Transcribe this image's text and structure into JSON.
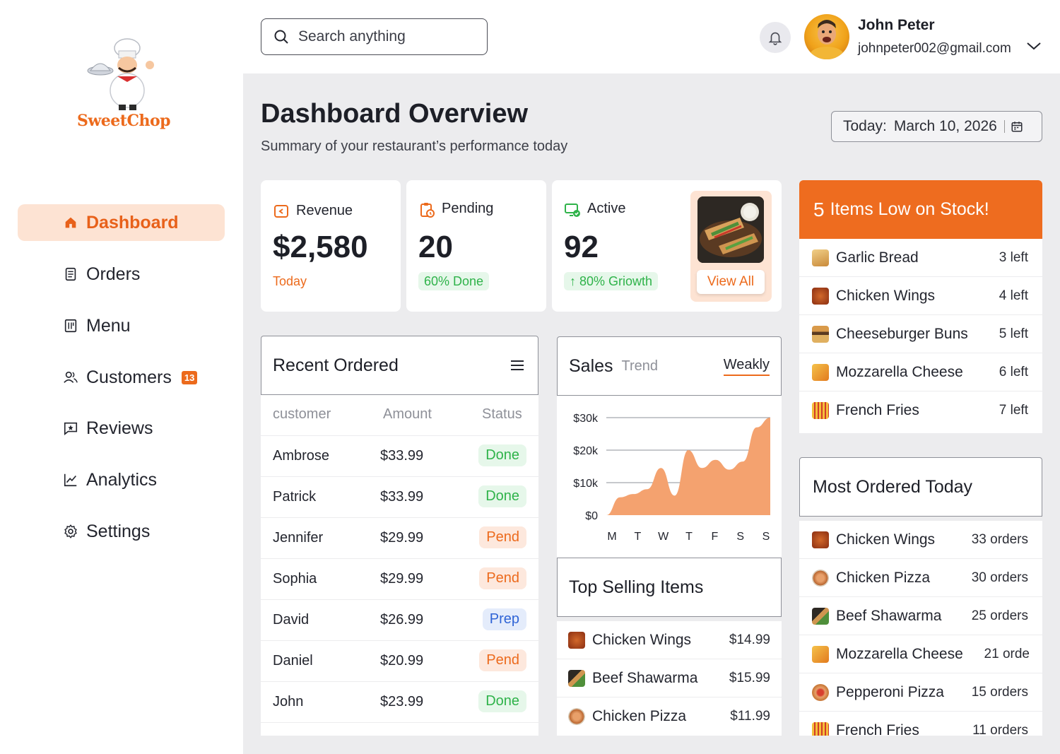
{
  "brand": {
    "name": "SweetChop"
  },
  "sidebar": {
    "items": [
      {
        "label": "Dashboard",
        "icon": "home-icon",
        "active": true
      },
      {
        "label": "Orders",
        "icon": "receipt-icon"
      },
      {
        "label": "Menu",
        "icon": "menu-book-icon"
      },
      {
        "label": "Customers",
        "icon": "users-icon",
        "badge": "13"
      },
      {
        "label": "Reviews",
        "icon": "star-message-icon"
      },
      {
        "label": "Analytics",
        "icon": "chart-line-icon"
      },
      {
        "label": "Settings",
        "icon": "gear-icon"
      }
    ]
  },
  "header": {
    "search_placeholder": "Search anything",
    "user_name": "John Peter",
    "user_email": "johnpeter002@gmail.com"
  },
  "page": {
    "title": "Dashboard Overview",
    "subtitle": "Summary of your restaurant’s performance today",
    "date_label": "Today:",
    "date_value": "March 10, 2026"
  },
  "stats": {
    "revenue": {
      "label": "Revenue",
      "value": "$2,580",
      "sub": "Today"
    },
    "pending": {
      "label": "Pending",
      "value": "20",
      "sub": "60% Done"
    },
    "active": {
      "label": "Active",
      "value": "92",
      "sub": "↑ 80% Griowth"
    },
    "view_all": "View All"
  },
  "recent_ordered": {
    "title": "Recent Ordered",
    "columns": [
      "customer",
      "Amount",
      "Status"
    ],
    "rows": [
      {
        "customer": "Ambrose",
        "amount": "$33.99",
        "status": "Done"
      },
      {
        "customer": "Patrick",
        "amount": "$33.99",
        "status": "Done"
      },
      {
        "customer": "Jennifer",
        "amount": "$29.99",
        "status": "Pend"
      },
      {
        "customer": "Sophia",
        "amount": "$29.99",
        "status": "Pend"
      },
      {
        "customer": "David",
        "amount": "$26.99",
        "status": "Prep"
      },
      {
        "customer": "Daniel",
        "amount": "$20.99",
        "status": "Pend"
      },
      {
        "customer": "John",
        "amount": "$23.99",
        "status": "Done"
      }
    ]
  },
  "sales": {
    "title": "Sales",
    "subtitle": "Trend",
    "period": "Weakly"
  },
  "chart_data": {
    "type": "area",
    "title": "",
    "xlabel": "",
    "ylabel": "",
    "categories": [
      "M",
      "T",
      "W",
      "T",
      "F",
      "S",
      "S"
    ],
    "y_ticks": [
      "$30k",
      "$20k",
      "$10k",
      "$0"
    ],
    "ylim": [
      0,
      30
    ],
    "x": [
      0,
      0.5,
      1,
      1.5,
      2,
      2.5,
      3,
      3.5,
      4,
      4.5,
      5,
      5.5,
      6
    ],
    "values": [
      0,
      5.5,
      6.5,
      8,
      14.5,
      6,
      20,
      14.5,
      17,
      14,
      16.5,
      27,
      30
    ],
    "color": "#f4a26f",
    "grid": true
  },
  "top_selling": {
    "title": "Top Selling Items",
    "items": [
      {
        "name": "Chicken Wings",
        "price": "$14.99"
      },
      {
        "name": "Beef Shawarma",
        "price": "$15.99"
      },
      {
        "name": "Chicken Pizza",
        "price": "$11.99"
      }
    ]
  },
  "low_stock": {
    "count": "5",
    "title": "Items Low on Stock!",
    "items": [
      {
        "name": "Garlic Bread",
        "left": "3 left"
      },
      {
        "name": "Chicken Wings",
        "left": "4 left"
      },
      {
        "name": "Cheeseburger Buns",
        "left": "5 left"
      },
      {
        "name": "Mozzarella Cheese",
        "left": "6 left"
      },
      {
        "name": "French Fries",
        "left": "7 left"
      }
    ]
  },
  "most_ordered": {
    "title": "Most Ordered Today",
    "items": [
      {
        "name": "Chicken Wings",
        "orders": "33 orders"
      },
      {
        "name": "Chicken Pizza",
        "orders": "30 orders"
      },
      {
        "name": "Beef Shawarma",
        "orders": "25 orders"
      },
      {
        "name": "Mozzarella Cheese",
        "orders": "21 orde"
      },
      {
        "name": "Pepperoni Pizza",
        "orders": "15 orders"
      },
      {
        "name": "French Fries",
        "orders": "11 orders"
      }
    ]
  },
  "colors": {
    "accent": "#ec6a1c",
    "accent_light": "#fde3d3",
    "success": "#2fb34a",
    "info": "#2f64d6",
    "background": "#ececee"
  }
}
